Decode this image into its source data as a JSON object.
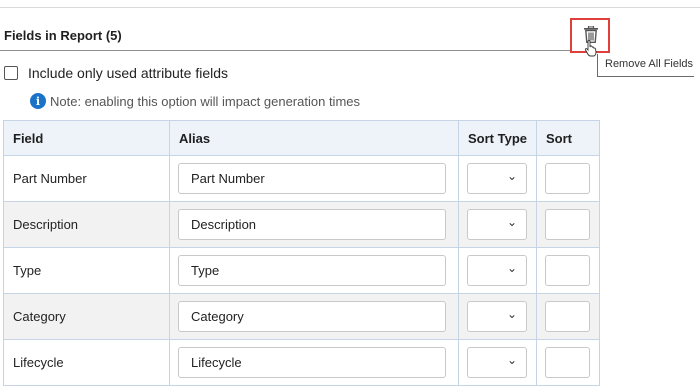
{
  "section": {
    "title": "Fields in Report (5)",
    "remove_all_tooltip": "Remove All Fields"
  },
  "options": {
    "include_used_label": "Include only used attribute fields",
    "include_used_checked": false,
    "note_icon_glyph": "i",
    "note_text": "Note: enabling this option will impact generation times"
  },
  "table": {
    "headers": {
      "field": "Field",
      "alias": "Alias",
      "sort_type": "Sort Type",
      "sort": "Sort"
    },
    "rows": [
      {
        "field": "Part Number",
        "alias": "Part Number",
        "sort_type": "",
        "sort": ""
      },
      {
        "field": "Description",
        "alias": "Description",
        "sort_type": "",
        "sort": ""
      },
      {
        "field": "Type",
        "alias": "Type",
        "sort_type": "",
        "sort": ""
      },
      {
        "field": "Category",
        "alias": "Category",
        "sort_type": "",
        "sort": ""
      },
      {
        "field": "Lifecycle",
        "alias": "Lifecycle",
        "sort_type": "",
        "sort": ""
      }
    ]
  },
  "icons": {
    "trash": "trash-icon",
    "info": "info-icon",
    "chevron": "chevron-down-icon",
    "cursor": "hand-pointer-icon"
  },
  "colors": {
    "highlight_border": "#e0403c",
    "info_blue": "#1a73c9",
    "header_bg": "#eef3f9",
    "alt_row_bg": "#f2f2f2",
    "grid_border": "#c5d5e6"
  }
}
